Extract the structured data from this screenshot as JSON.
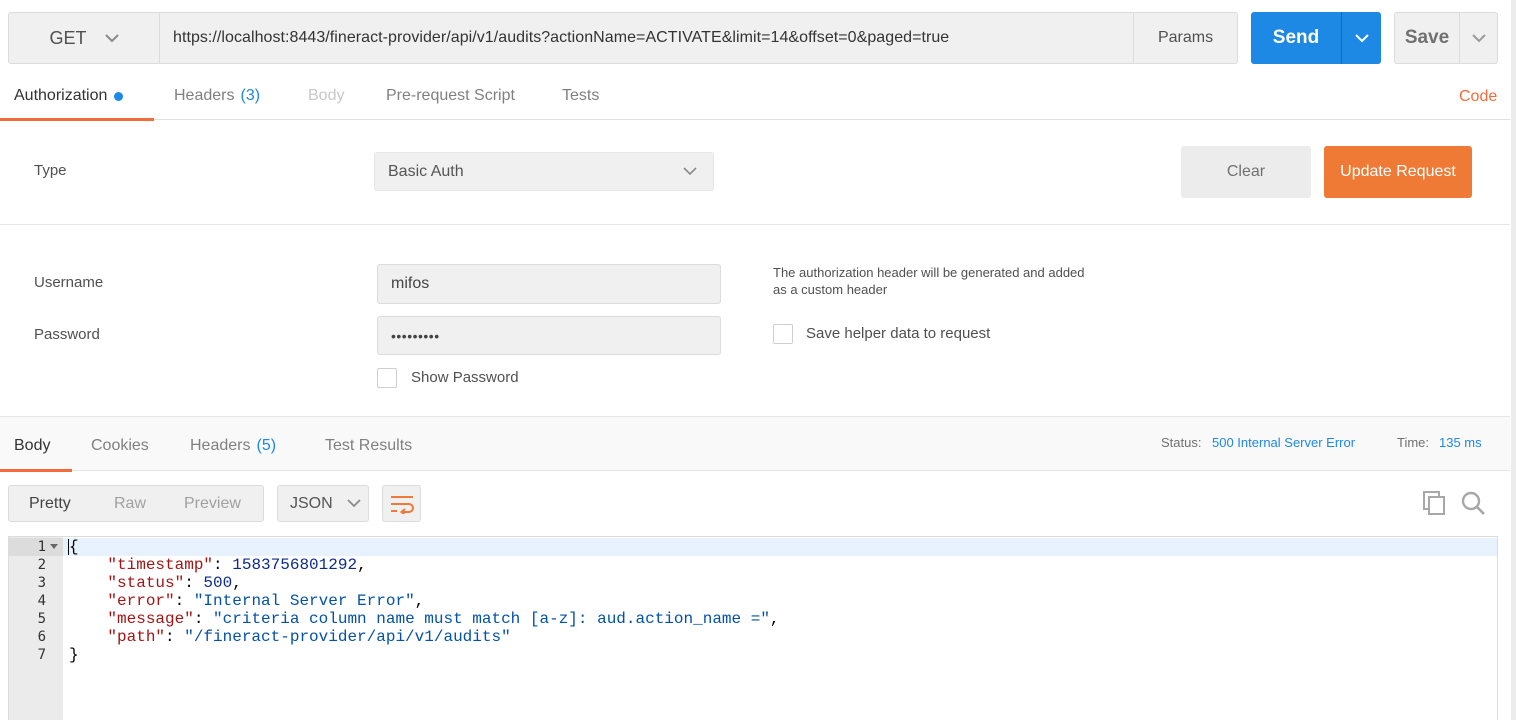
{
  "request": {
    "method": "GET",
    "url": "https://localhost:8443/fineract-provider/api/v1/audits?actionName=ACTIVATE&limit=14&offset=0&paged=true",
    "params_label": "Params",
    "send_label": "Send",
    "save_label": "Save"
  },
  "request_tabs": {
    "authorization": "Authorization",
    "headers": "Headers",
    "headers_count": "(3)",
    "body": "Body",
    "prerequest": "Pre-request Script",
    "tests": "Tests",
    "code": "Code"
  },
  "auth": {
    "type_label": "Type",
    "type_value": "Basic Auth",
    "clear_label": "Clear",
    "update_label": "Update Request",
    "username_label": "Username",
    "username_value": "mifos",
    "password_label": "Password",
    "password_value": "•••••••••",
    "show_password_label": "Show Password",
    "hint": "The authorization header will be generated and added as a custom header",
    "save_helper_label": "Save helper data to request"
  },
  "response_tabs": {
    "body": "Body",
    "cookies": "Cookies",
    "headers": "Headers",
    "headers_count": "(5)",
    "test_results": "Test Results"
  },
  "response_status": {
    "status_label": "Status:",
    "status_value": "500 Internal Server Error",
    "time_label": "Time:",
    "time_value": "135 ms"
  },
  "view": {
    "pretty": "Pretty",
    "raw": "Raw",
    "preview": "Preview",
    "format": "JSON"
  },
  "code_lines": {
    "l1": "{",
    "l2_key": "\"timestamp\"",
    "l2_val": "1583756801292",
    "l3_key": "\"status\"",
    "l3_val": "500",
    "l4_key": "\"error\"",
    "l4_val": "\"Internal Server Error\"",
    "l5_key": "\"message\"",
    "l5_val": "\"criteria column name must match [a-z]: aud.action_name =\"",
    "l6_key": "\"path\"",
    "l6_val": "\"/fineract-provider/api/v1/audits\"",
    "l7": "}"
  },
  "line_numbers": [
    "1",
    "2",
    "3",
    "4",
    "5",
    "6",
    "7"
  ],
  "colors": {
    "accent_blue": "#1e88e5",
    "accent_orange": "#ef7a36"
  }
}
